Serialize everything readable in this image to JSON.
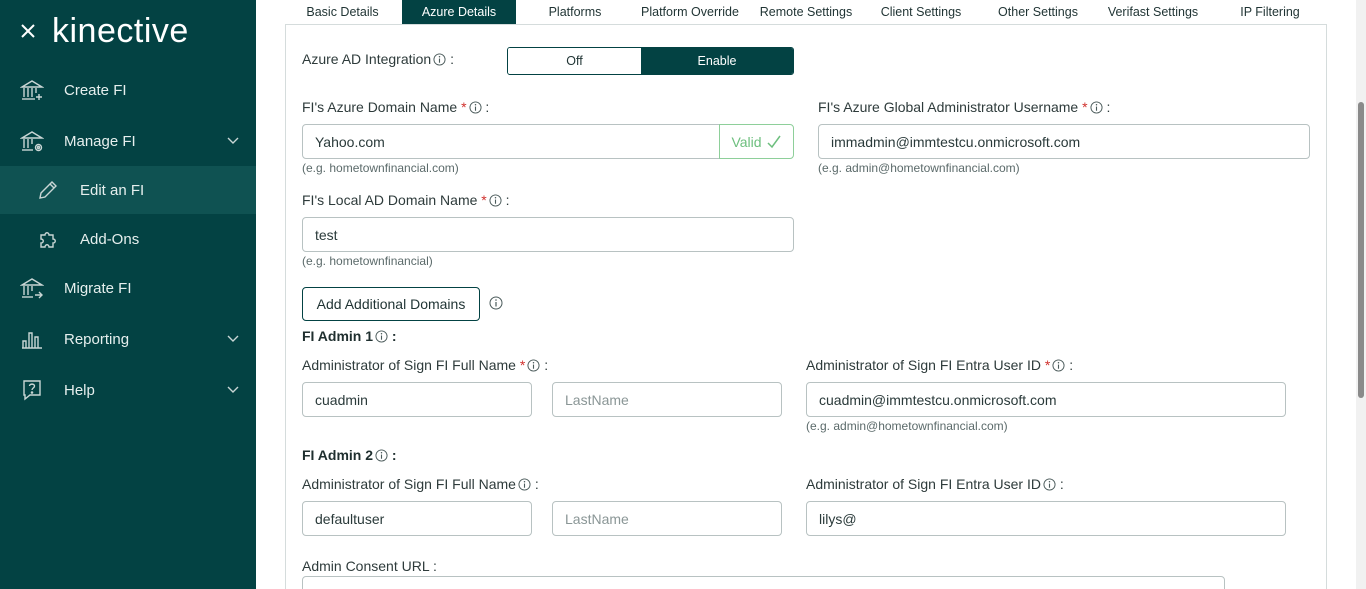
{
  "sidebar": {
    "logo": "kinective",
    "items": [
      {
        "label": "Create FI",
        "icon": "bank-plus-icon"
      },
      {
        "label": "Manage FI",
        "icon": "bank-gear-icon"
      },
      {
        "label": "Edit an FI",
        "icon": "pencil-icon"
      },
      {
        "label": "Add-Ons",
        "icon": "puzzle-icon"
      },
      {
        "label": "Migrate FI",
        "icon": "bank-arrow-icon"
      },
      {
        "label": "Reporting",
        "icon": "bar-chart-icon"
      },
      {
        "label": "Help",
        "icon": "question-icon"
      }
    ]
  },
  "tabs": [
    {
      "label": "Basic Details"
    },
    {
      "label": "Azure Details"
    },
    {
      "label": "Platforms"
    },
    {
      "label": "Platform Override"
    },
    {
      "label": "Remote Settings"
    },
    {
      "label": "Client Settings"
    },
    {
      "label": "Other Settings"
    },
    {
      "label": "Verifast Settings"
    },
    {
      "label": "IP Filtering"
    }
  ],
  "form": {
    "azure_ad": {
      "label": "Azure AD Integration",
      "suffix": ":",
      "off": "Off",
      "on": "Enable"
    },
    "domain": {
      "label": "FI's Azure Domain Name",
      "value": "Yahoo.com",
      "valid": "Valid",
      "hint": "(e.g. hometownfinancial.com)"
    },
    "global_admin": {
      "label": "FI's Azure Global Administrator Username",
      "value": "immadmin@immtestcu.onmicrosoft.com",
      "hint": "(e.g. admin@hometownfinancial.com)"
    },
    "local_domain": {
      "label": "FI's Local AD Domain Name",
      "value": "test",
      "hint": "(e.g. hometownfinancial)"
    },
    "add_domains": "Add Additional Domains",
    "admin1": {
      "title": "FI Admin 1",
      "full_name_label": "Administrator of Sign FI Full Name",
      "first": "cuadmin",
      "last_placeholder": "LastName",
      "entra_label": "Administrator of Sign FI Entra User ID",
      "entra_value": "cuadmin@immtestcu.onmicrosoft.com",
      "entra_hint": "(e.g. admin@hometownfinancial.com)"
    },
    "admin2": {
      "title": "FI Admin 2",
      "full_name_label": "Administrator of Sign FI Full Name",
      "first": "defaultuser",
      "last_placeholder": "LastName",
      "entra_label": "Administrator of Sign FI Entra User ID",
      "entra_value": "lilys@"
    },
    "consent": {
      "label": "Admin Consent URL :"
    }
  },
  "colors": {
    "brand": "#034243",
    "valid": "#6dbf7e",
    "required": "#d0312d"
  }
}
